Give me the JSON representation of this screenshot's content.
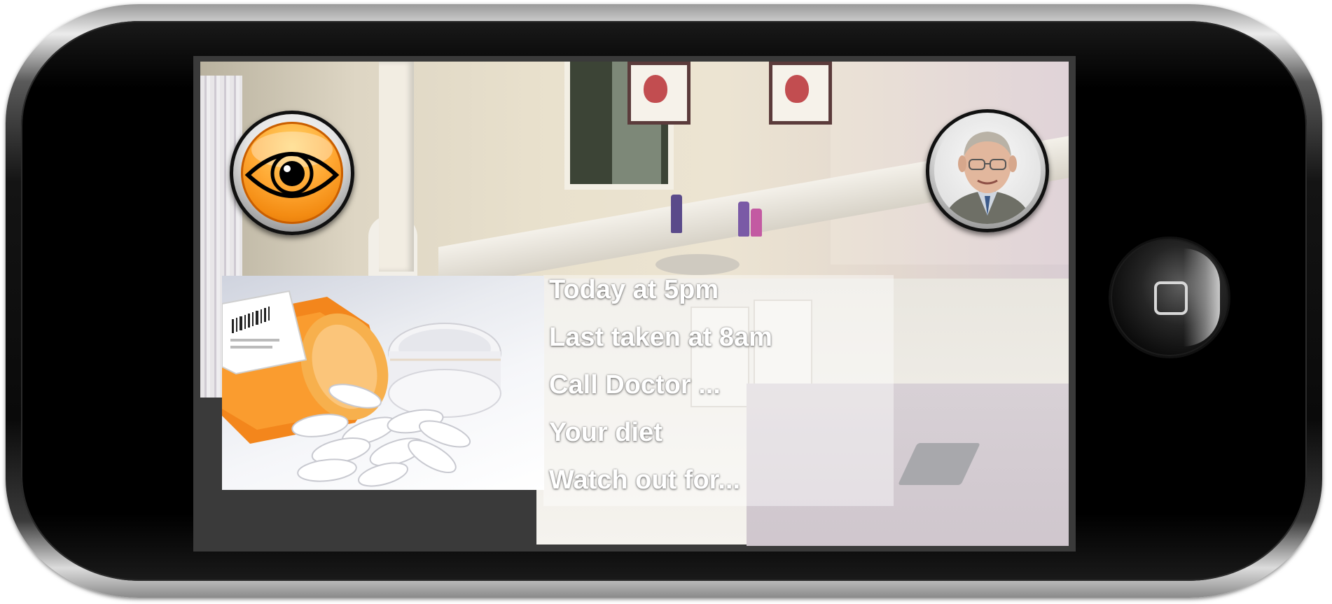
{
  "device": {
    "name": "phone",
    "accent": "#f59a1f"
  },
  "screen": {
    "background": "bathroom-scene",
    "left_button_icon": "eye-icon",
    "right_button_icon": "doctor-avatar",
    "image_subject": "pill-bottle-with-pills"
  },
  "menu": {
    "items": [
      {
        "label": "Today at 5pm"
      },
      {
        "label": "Last taken at 8am"
      },
      {
        "label": "Call Doctor ..."
      },
      {
        "label": "Your diet"
      },
      {
        "label": "Watch out for..."
      }
    ]
  },
  "home_button": {
    "icon": "home-square-icon"
  }
}
